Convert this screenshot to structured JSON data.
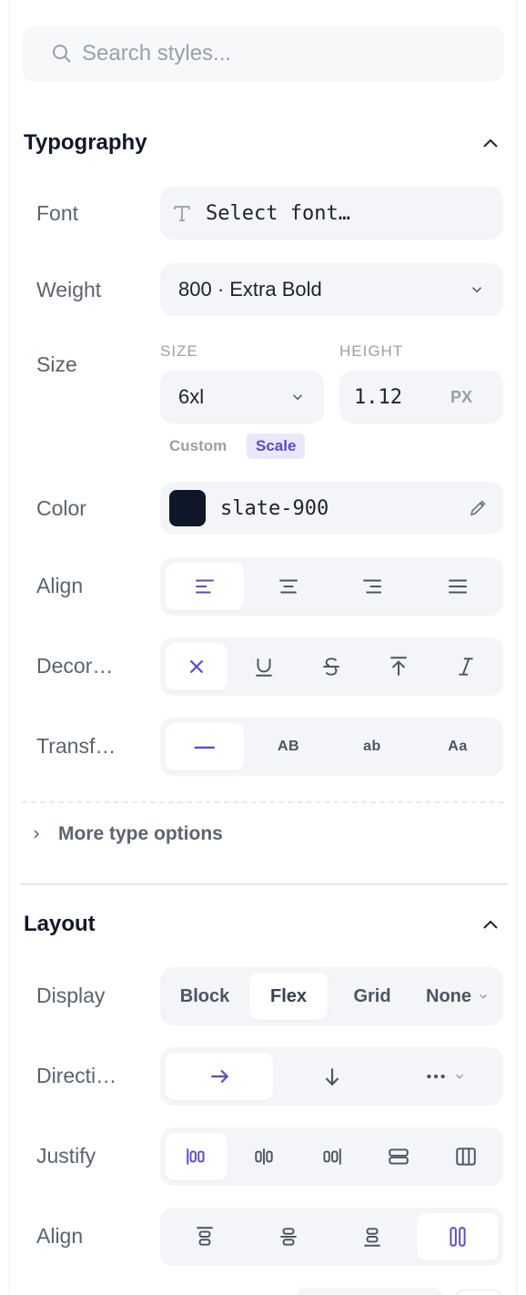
{
  "search": {
    "placeholder": "Search styles..."
  },
  "typography": {
    "title": "Typography",
    "font": {
      "label": "Font",
      "value": "Select font…"
    },
    "weight": {
      "label": "Weight",
      "value": "800 · Extra Bold"
    },
    "size": {
      "label": "Size",
      "size_label": "SIZE",
      "height_label": "HEIGHT",
      "size_value": "6xl",
      "height_value": "1.12",
      "height_unit": "PX",
      "mode_custom": "Custom",
      "mode_scale": "Scale",
      "active_mode": "Scale"
    },
    "color": {
      "label": "Color",
      "value": "slate-900",
      "swatch": "#0f172a"
    },
    "align": {
      "label": "Align",
      "options": [
        "align-left-icon",
        "align-center-icon",
        "align-right-icon",
        "align-justify-icon"
      ],
      "active": 0
    },
    "decoration": {
      "label": "Decor…",
      "options": [
        "none-x-icon",
        "underline-icon",
        "strikethrough-icon",
        "overline-icon",
        "italic-icon"
      ],
      "active": 0
    },
    "transform": {
      "label": "Transf…",
      "options": [
        "—",
        "AB",
        "ab",
        "Aa"
      ],
      "active": 0
    },
    "more_label": "More type options"
  },
  "layout": {
    "title": "Layout",
    "display": {
      "label": "Display",
      "options": [
        "Block",
        "Flex",
        "Grid",
        "None"
      ],
      "active": "Flex"
    },
    "direction": {
      "label": "Directi…",
      "options": [
        "arrow-right-icon",
        "arrow-down-icon",
        "more-icon"
      ],
      "active": 0
    },
    "justify": {
      "label": "Justify",
      "options": [
        "justify-start-icon",
        "justify-center-icon",
        "justify-end-icon",
        "justify-between-icon",
        "justify-around-icon"
      ],
      "active": 0
    },
    "align": {
      "label": "Align",
      "options": [
        "align-items-start-icon",
        "align-items-center-icon",
        "align-items-end-icon",
        "align-items-stretch-icon"
      ],
      "active": 3
    }
  },
  "colors": {
    "accent": "#5b4bc4",
    "accent_bg": "#ebe7fb",
    "icon": "#4b5563",
    "muted": "#9aa0a8"
  }
}
